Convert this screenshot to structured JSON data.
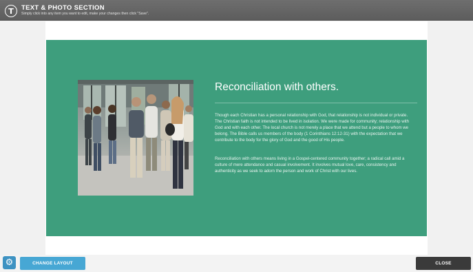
{
  "header": {
    "logo_letter": "T",
    "title": "TEXT & PHOTO SECTION",
    "subtitle": "Simply click into any item you want to edit, make your changes then click \"Save\"."
  },
  "section": {
    "background_color": "#3e9e7d",
    "heading": "Reconciliation with others.",
    "paragraphs": [
      "Though each Christian has a personal relationship with God, that relationship is not individual or private. The Christian faith is not intended to be lived in isolation. We were made for community; relationship with God and with each other. The local church is not merely a place that we attend but a people to whom we belong. The Bible calls us members of the body (1 Corinthians 12:12-31) with the expectation that we contribute to the body for the glory of God and the good of His people.",
      "Reconciliation with others means living in a Gospel-centered community together; a radical call amid a culture of mere attendance and casual involvement. It involves mutual love, care, consistency and authenticity as we seek to adorn the person and work of Christ with our lives."
    ]
  },
  "footer": {
    "settings_icon": "gear-icon",
    "change_layout_label": "CHANGE LAYOUT",
    "close_label": "CLOSE"
  },
  "colors": {
    "accent_blue": "#47a7d4",
    "dark_button": "#3a3a3a"
  }
}
